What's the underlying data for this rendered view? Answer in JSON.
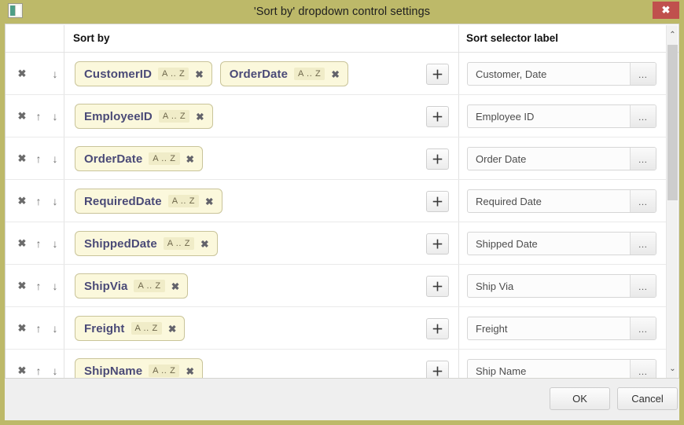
{
  "window": {
    "title": "'Sort by' dropdown control settings",
    "app_icon": "window-icon",
    "close_label": "✖",
    "chrome_color": "#bdb969",
    "close_color": "#c0504d"
  },
  "grid": {
    "columns": [
      {
        "key": "sort_by",
        "label": "Sort by"
      },
      {
        "key": "sort_selector_label",
        "label": "Sort selector label"
      }
    ],
    "actions": {
      "remove": "✖",
      "move_up": "↑",
      "move_down": "↓",
      "add": "＋",
      "ellipsis": "…"
    },
    "chip": {
      "sort_direction_badge": "A .. Z",
      "remove": "✖"
    },
    "rows": [
      {
        "can_move_up": false,
        "can_move_down": true,
        "chips": [
          {
            "field": "CustomerID",
            "direction": "A .. Z"
          },
          {
            "field": "OrderDate",
            "direction": "A .. Z"
          }
        ],
        "label": "Customer, Date"
      },
      {
        "can_move_up": true,
        "can_move_down": true,
        "chips": [
          {
            "field": "EmployeeID",
            "direction": "A .. Z"
          }
        ],
        "label": "Employee ID"
      },
      {
        "can_move_up": true,
        "can_move_down": true,
        "chips": [
          {
            "field": "OrderDate",
            "direction": "A .. Z"
          }
        ],
        "label": "Order Date"
      },
      {
        "can_move_up": true,
        "can_move_down": true,
        "chips": [
          {
            "field": "RequiredDate",
            "direction": "A .. Z"
          }
        ],
        "label": "Required Date"
      },
      {
        "can_move_up": true,
        "can_move_down": true,
        "chips": [
          {
            "field": "ShippedDate",
            "direction": "A .. Z"
          }
        ],
        "label": "Shipped Date"
      },
      {
        "can_move_up": true,
        "can_move_down": true,
        "chips": [
          {
            "field": "ShipVia",
            "direction": "A .. Z"
          }
        ],
        "label": "Ship Via"
      },
      {
        "can_move_up": true,
        "can_move_down": true,
        "chips": [
          {
            "field": "Freight",
            "direction": "A .. Z"
          }
        ],
        "label": "Freight"
      },
      {
        "can_move_up": true,
        "can_move_down": true,
        "chips": [
          {
            "field": "ShipName",
            "direction": "A .. Z"
          }
        ],
        "label": "Ship Name"
      }
    ]
  },
  "scrollbar": {
    "up": "⌃",
    "down": "⌄"
  },
  "footer": {
    "ok_label": "OK",
    "cancel_label": "Cancel"
  }
}
